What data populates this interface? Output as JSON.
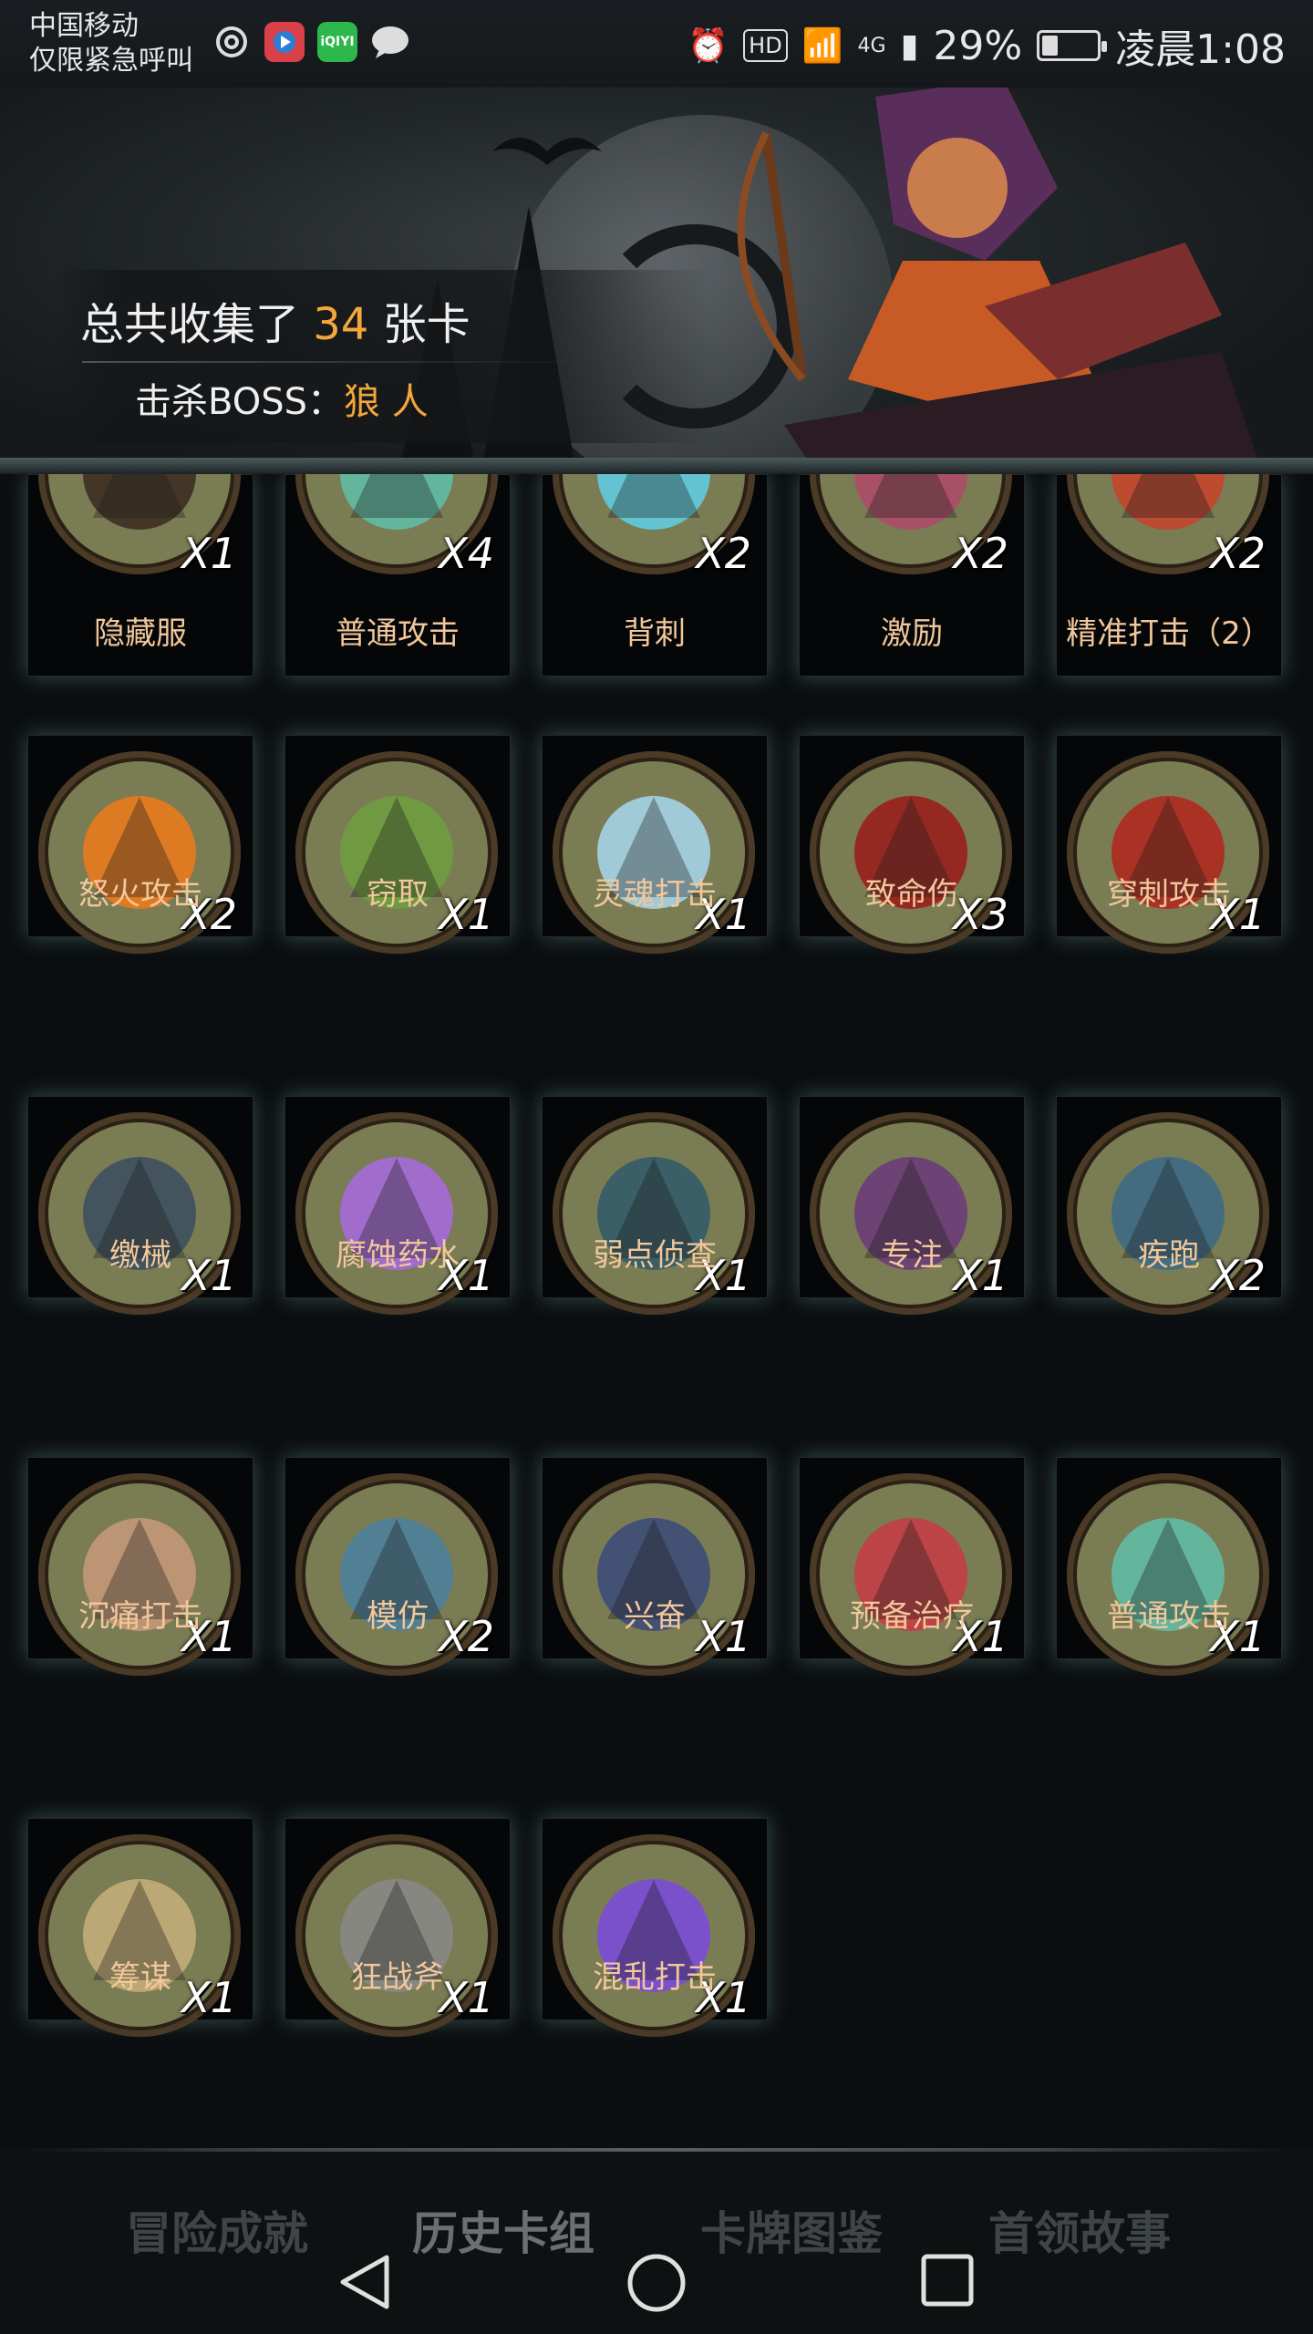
{
  "status_bar": {
    "carrier": "中国移动",
    "carrier_sub": "仅限紧急呼叫",
    "left_icons": [
      "netease-icon",
      "video-app-icon",
      "iqiyi-icon",
      "chat-icon"
    ],
    "iqiyi_label": "iQIYI",
    "hd_label": "HD",
    "network_label": "4G",
    "battery_percent": "29%",
    "battery_level": 0.29,
    "time": "凌晨1:08"
  },
  "header": {
    "collected_prefix": "总共收集了 ",
    "collected_count": "34",
    "collected_suffix": " 张卡",
    "boss_label": "击杀BOSS：",
    "boss_name": "狼 人"
  },
  "cards": [
    {
      "name": "隐藏服",
      "count": "X1",
      "icon": "cloak-icon"
    },
    {
      "name": "普通攻击",
      "count": "X4",
      "icon": "arrow-strike-icon"
    },
    {
      "name": "背刺",
      "count": "X2",
      "icon": "backstab-icon"
    },
    {
      "name": "激励",
      "count": "X2",
      "icon": "inspire-icon"
    },
    {
      "name": "精准打击（2）",
      "count": "X2",
      "icon": "target-icon"
    },
    {
      "name": "怒火攻击",
      "count": "X2",
      "icon": "flame-icon"
    },
    {
      "name": "窃取",
      "count": "X1",
      "icon": "goblin-chest-icon"
    },
    {
      "name": "灵魂打击",
      "count": "X1",
      "icon": "ice-shard-icon"
    },
    {
      "name": "致命伤",
      "count": "X3",
      "icon": "blood-dagger-icon"
    },
    {
      "name": "穿刺攻击",
      "count": "X1",
      "icon": "spikes-icon"
    },
    {
      "name": "缴械",
      "count": "X1",
      "icon": "shield-gear-icon"
    },
    {
      "name": "腐蚀药水",
      "count": "X1",
      "icon": "potion-icon"
    },
    {
      "name": "弱点侦查",
      "count": "X1",
      "icon": "wolf-icon"
    },
    {
      "name": "专注",
      "count": "X1",
      "icon": "wizard-icon"
    },
    {
      "name": "疾跑",
      "count": "X2",
      "icon": "running-beast-icon"
    },
    {
      "name": "沉痛打击",
      "count": "X1",
      "icon": "ogre-icon"
    },
    {
      "name": "模仿",
      "count": "X2",
      "icon": "troll-face-icon"
    },
    {
      "name": "兴奋",
      "count": "X1",
      "icon": "dwarf-hammer-icon"
    },
    {
      "name": "预备治疗",
      "count": "X1",
      "icon": "heart-cross-icon"
    },
    {
      "name": "普通攻击",
      "count": "X1",
      "icon": "arrow-strike-icon"
    },
    {
      "name": "筹谋",
      "count": "X1",
      "icon": "map-icon"
    },
    {
      "name": "狂战斧",
      "count": "X1",
      "icon": "axe-icon"
    },
    {
      "name": "混乱打击",
      "count": "X1",
      "icon": "purple-blade-icon"
    }
  ],
  "tabs": [
    {
      "label": "冒险成就",
      "active": false
    },
    {
      "label": "历史卡组",
      "active": true
    },
    {
      "label": "卡牌图鉴",
      "active": false
    },
    {
      "label": "首领故事",
      "active": false
    }
  ],
  "nav": {
    "back": "back-triangle-icon",
    "home": "home-circle-icon",
    "recents": "recents-square-icon"
  }
}
